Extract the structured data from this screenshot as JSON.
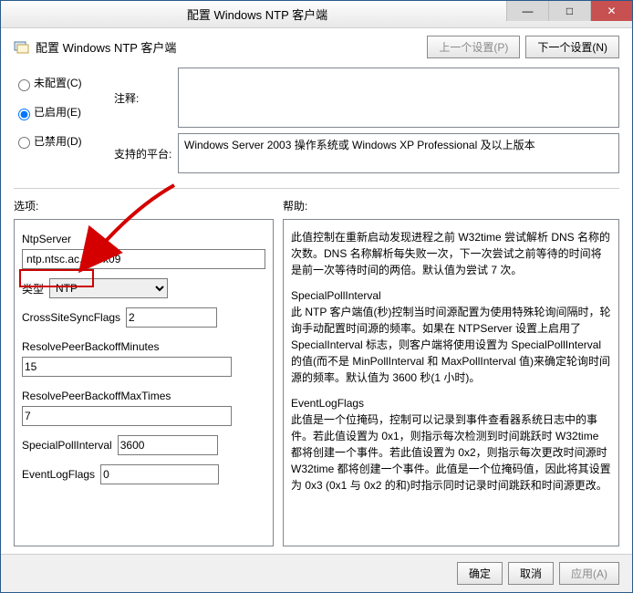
{
  "window": {
    "title": "配置 Windows NTP 客户端"
  },
  "header": {
    "title": "配置 Windows NTP 客户端",
    "prev": "上一个设置(P)",
    "next": "下一个设置(N)"
  },
  "radios": {
    "not_configured": "未配置(C)",
    "enabled": "已启用(E)",
    "disabled": "已禁用(D)",
    "selected": "enabled"
  },
  "meta": {
    "comment_label": "注释:",
    "comment_value": "",
    "supported_label": "支持的平台:",
    "supported_value": "Windows Server 2003 操作系统或 Windows XP Professional 及以上版本"
  },
  "panels": {
    "options_label": "选项:",
    "help_label": "帮助:"
  },
  "options": {
    "ntp_server_label": "NtpServer",
    "ntp_server_value": "ntp.ntsc.ac.cn,0x09",
    "type_label": "类型",
    "type_value": "NTP",
    "cross_site_label": "CrossSiteSyncFlags",
    "cross_site_value": "2",
    "resolve_minutes_label": "ResolvePeerBackoffMinutes",
    "resolve_minutes_value": "15",
    "resolve_max_label": "ResolvePeerBackoffMaxTimes",
    "resolve_max_value": "7",
    "special_poll_label": "SpecialPollInterval",
    "special_poll_value": "3600",
    "event_flags_label": "EventLogFlags",
    "event_flags_value": "0"
  },
  "help": {
    "p1": "此值控制在重新启动发现进程之前 W32time 尝试解析 DNS 名称的次数。DNS 名称解析每失败一次，下一次尝试之前等待的时间将是前一次等待时间的两倍。默认值为尝试 7 次。",
    "p2h": "SpecialPollInterval",
    "p2": "此 NTP 客户端值(秒)控制当时间源配置为使用特殊轮询间隔时，轮询手动配置时间源的频率。如果在 NTPServer 设置上启用了 SpecialInterval 标志，则客户端将使用设置为 SpecialPollInterval 的值(而不是 MinPollInterval 和 MaxPollInterval 值)来确定轮询时间源的频率。默认值为 3600 秒(1 小时)。",
    "p3h": "EventLogFlags",
    "p3": "此值是一个位掩码，控制可以记录到事件查看器系统日志中的事件。若此值设置为 0x1，则指示每次检测到时间跳跃时 W32time 都将创建一个事件。若此值设置为 0x2，则指示每次更改时间源时 W32time 都将创建一个事件。此值是一个位掩码值，因此将其设置为 0x3 (0x1 与 0x2 的和)时指示同时记录时间跳跃和时间源更改。"
  },
  "footer": {
    "ok": "确定",
    "cancel": "取消",
    "apply": "应用(A)"
  }
}
